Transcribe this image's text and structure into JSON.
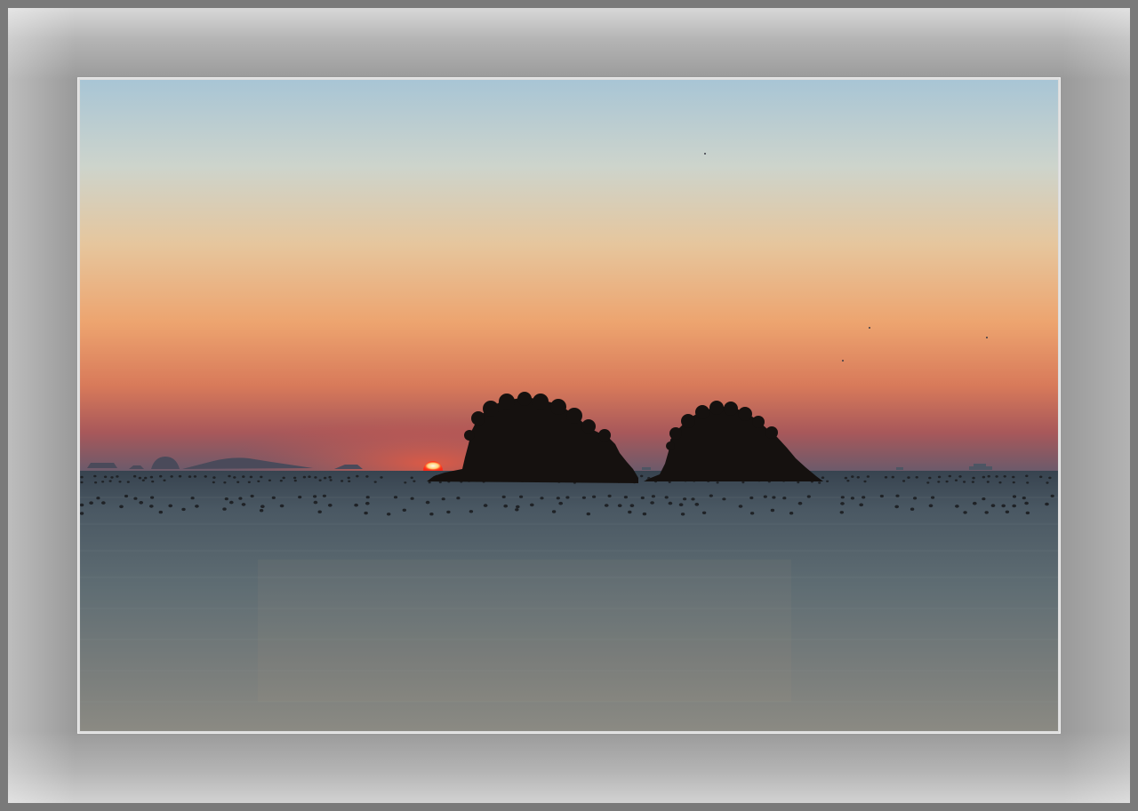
{
  "image": {
    "subject": "sunset-over-sea-with-two-islands",
    "colors": {
      "sky_top": "#a9c6d6",
      "sky_mid": "#e7c9a2",
      "sky_low": "#ee9f6a",
      "horizon_glow": "#c8574d",
      "haze": "#6f5a6a",
      "sun": "#ff3a20",
      "sun_core": "#fff6e0",
      "island": "#15110f",
      "sea_top": "#3d4a55",
      "sea_mid": "#5e6c72",
      "sea_bottom": "#8a8a84",
      "frame": "#9a9a9a"
    }
  }
}
